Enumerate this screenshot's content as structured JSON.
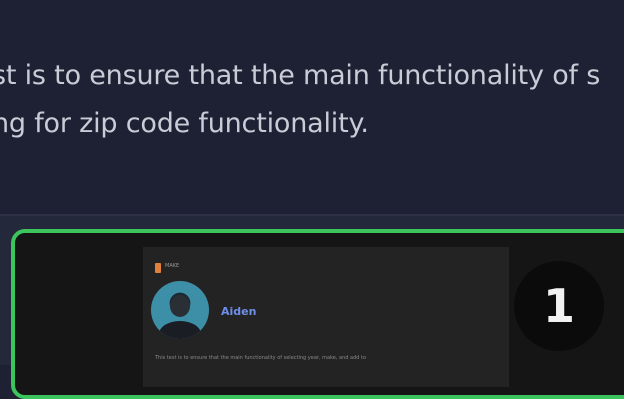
{
  "paragraph": {
    "line1": "st is to ensure that the main functionality of s",
    "line2": "ng for zip code functionality."
  },
  "screenshot_card": {
    "brand": "MAKE",
    "user_name": "Aiden",
    "caption": "This test is to ensure that the main functionality of selecting year, make, and add to",
    "step_number": "1",
    "border_color": "#3cc55d"
  }
}
